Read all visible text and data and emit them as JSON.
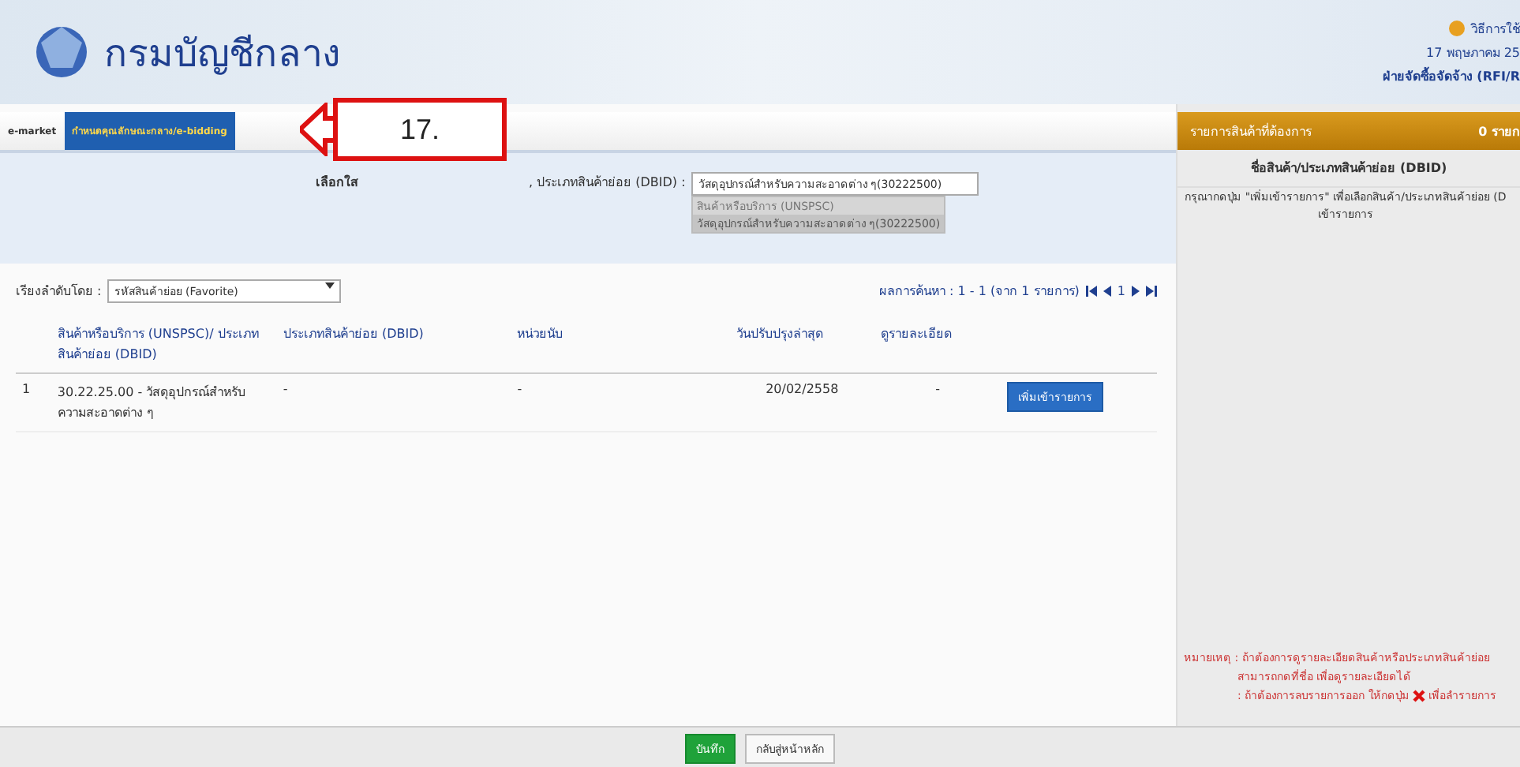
{
  "header": {
    "title": "กรมบัญชีกลาง",
    "help_link": "วิธีการใช้",
    "date": "17 พฤษภาคม 25",
    "user": "ฝ่ายจัดซื้อจัดจ้าง (RFI/R"
  },
  "tabs": [
    {
      "label": "e-market",
      "selected": false
    },
    {
      "label": "กำหนดคุณลักษณะกลาง/e-bidding",
      "selected": true
    }
  ],
  "callout": {
    "label": "17."
  },
  "search": {
    "label_start": "เลือกใส",
    "label_end": ", ประเภทสินค้าย่อย (DBID) :",
    "value": "วัสดุอุปกรณ์สำหรับความสะอาดต่าง ๆ(30222500)",
    "suggestions": [
      {
        "label": "สินค้าหรือบริการ (UNSPSC)",
        "selected": false
      },
      {
        "label": "วัสดุอุปกรณ์สำหรับความสะอาดต่าง ๆ(30222500)",
        "selected": true
      }
    ]
  },
  "sort": {
    "label": "เรียงลำดับโดย :",
    "value": "รหัสสินค้าย่อย (Favorite)"
  },
  "pagination": {
    "summary": "ผลการค้นหา : 1 - 1 (จาก 1 รายการ)",
    "page": "1"
  },
  "table": {
    "columns": [
      "",
      "สินค้าหรือบริการ (UNSPSC)/ ประเภทสินค้าย่อย (DBID)",
      "ประเภทสินค้าย่อย (DBID)",
      "หน่วยนับ",
      "วันปรับปรุงล่าสุด",
      "ดูรายละเอียด",
      ""
    ],
    "rows": [
      {
        "index": "1",
        "item": "30.22.25.00 - วัสดุอุปกรณ์สำหรับความสะอาดต่าง ๆ",
        "dbid": "-",
        "unit": "-",
        "updated": "20/02/2558",
        "details": "-",
        "action": "เพิ่มเข้ารายการ"
      }
    ]
  },
  "cart": {
    "title": "รายการสินค้าที่ต้องการ",
    "count": "0 รายก",
    "column": "ชื่อสินค้า/ประเภทสินค้าย่อย (DBID)",
    "hint_lines": [
      "กรุณากดปุ่ม \"เพิ่มเข้ารายการ\" เพื่อเลือกสินค้า/ประเภทสินค้าย่อย (D",
      "เข้ารายการ"
    ],
    "note_label": "หมายเหตุ :",
    "note_lines": [
      "ถ้าต้องการดูรายละเอียดสินค้าหรือประเภทสินค้าย่อย",
      "สามารถกดที่ชื่อ เพื่อดูรายละเอียดได้"
    ],
    "note_delete_start": ": ถ้าต้องการลบรายการออก ให้กดปุ่ม",
    "note_delete_end": "เพื่อลำรายการ"
  },
  "buttons": [
    {
      "label": "บันทึก",
      "kind": "primary"
    },
    {
      "label": "กลับสู่หน้าหลัก",
      "kind": "secondary"
    }
  ]
}
